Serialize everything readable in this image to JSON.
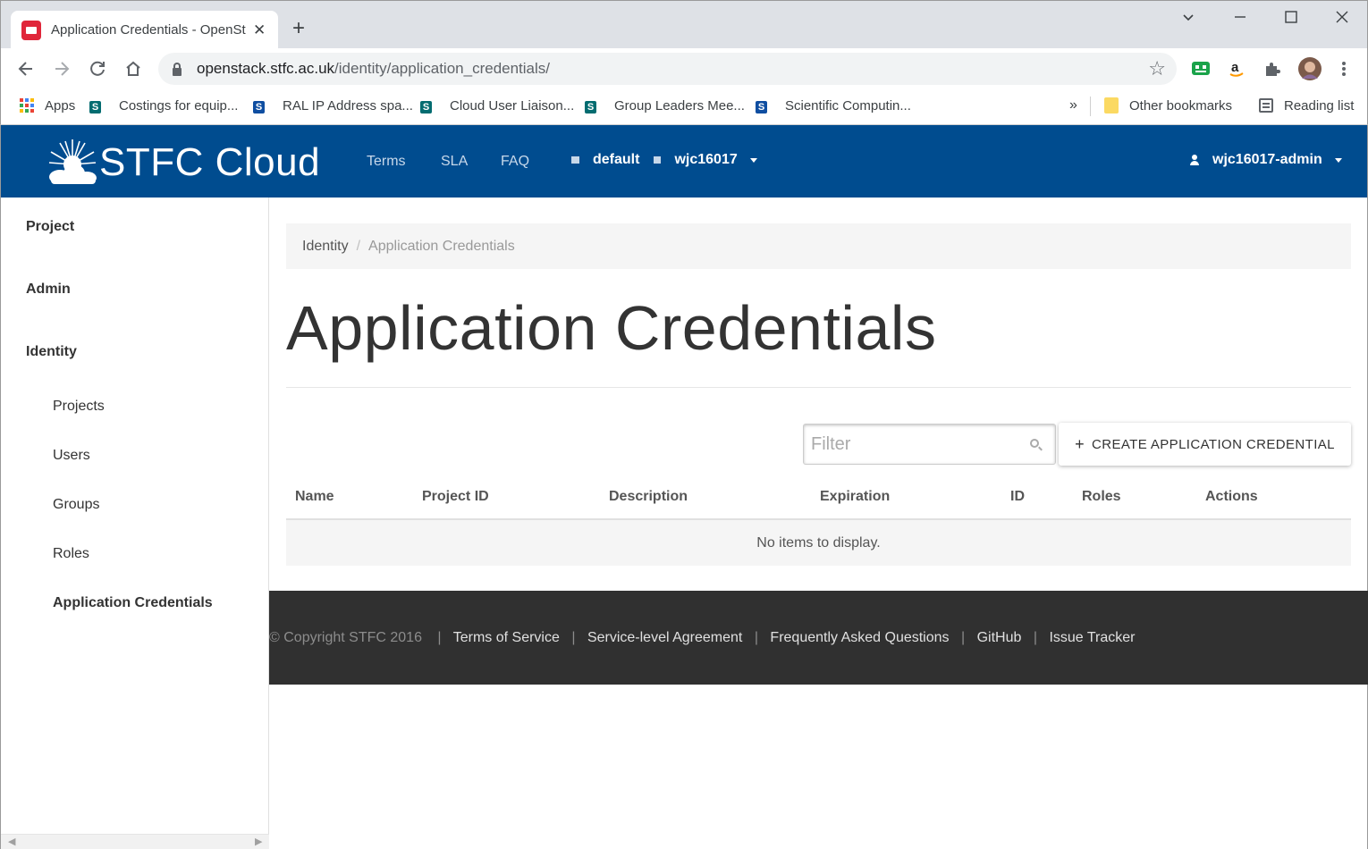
{
  "browser": {
    "tab_title": "Application Credentials - OpenSt",
    "tab_close": "✕",
    "new_tab": "+",
    "url_host": "openstack.stfc.ac.uk",
    "url_path": "/identity/application_credentials/",
    "bookmarks": [
      {
        "label": "Apps",
        "icon": "apps-grid-icon"
      },
      {
        "label": "Costings for equip...",
        "icon": "sharepoint-icon"
      },
      {
        "label": "RAL IP Address spa...",
        "icon": "sharepoint-site-icon"
      },
      {
        "label": "Cloud User Liaison...",
        "icon": "sharepoint-icon"
      },
      {
        "label": "Group Leaders Mee...",
        "icon": "sharepoint-icon"
      },
      {
        "label": "Scientific Computin...",
        "icon": "sharepoint-site-icon"
      }
    ],
    "bookmarks_overflow": "»",
    "other_bookmarks": "Other bookmarks",
    "reading_list": "Reading list"
  },
  "header": {
    "brand": "STFC Cloud",
    "nav": [
      "Terms",
      "SLA",
      "FAQ"
    ],
    "domain": "default",
    "project": "wjc16017",
    "user": "wjc16017-admin",
    "brand_color": "#004c8f"
  },
  "sidebar": {
    "sections": [
      "Project",
      "Admin",
      "Identity"
    ],
    "items": [
      "Projects",
      "Users",
      "Groups",
      "Roles",
      "Application Credentials"
    ],
    "active_item": "Application Credentials"
  },
  "main": {
    "breadcrumb": {
      "parent": "Identity",
      "separator": "/",
      "current": "Application Credentials"
    },
    "title": "Application Credentials",
    "filter_placeholder": "Filter",
    "create_button": "CREATE APPLICATION CREDENTIAL",
    "create_button_icon": "+",
    "columns": [
      "Name",
      "Project ID",
      "Description",
      "Expiration",
      "ID",
      "Roles",
      "Actions"
    ],
    "empty_message": "No items to display."
  },
  "footer": {
    "copyright": "© Copyright STFC 2016",
    "separator": "|",
    "links": [
      "Terms of Service",
      "Service-level Agreement",
      "Frequently Asked Questions",
      "GitHub",
      "Issue Tracker"
    ]
  }
}
